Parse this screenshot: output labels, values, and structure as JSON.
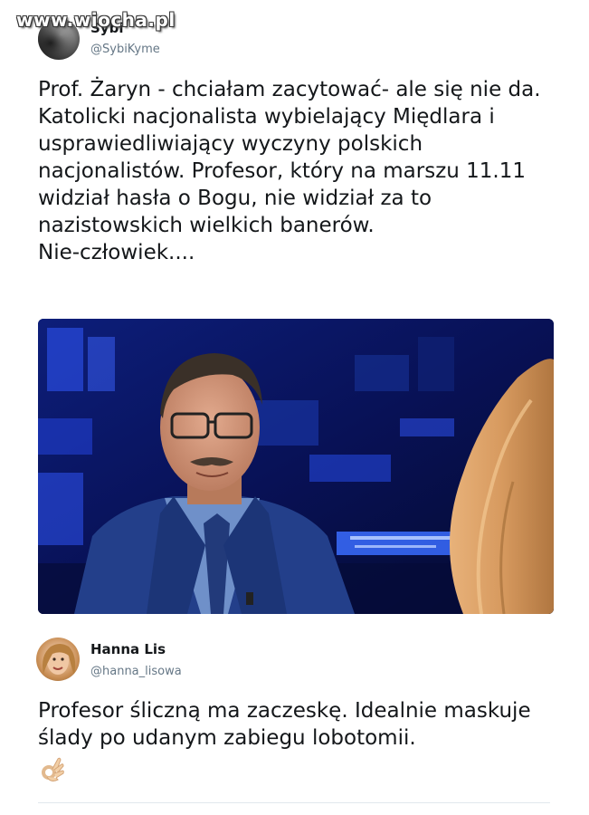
{
  "watermark": "www.wiocha.pl",
  "tweets": [
    {
      "name": "Sybi",
      "handle": "@SybiKyme",
      "text": "Prof. Żaryn - chciałam zacytować- ale się nie da.\nKatolicki nacjonalista wybielający Międlara i usprawiedliwiający wyczyny polskich nacjonalistów. Profesor, który na marszu 11.11 widział hasła o Bogu, nie widział za to nazistowskich wielkich banerów.\nNie-człowiek...."
    },
    {
      "name": "Hanna Lis",
      "handle": "@hanna_lisowa",
      "text": "Profesor śliczną ma zaczeskę. Idealnie maskuje ślady po udanym zabiegu lobotomii.",
      "emoji": "ok-hand-icon"
    }
  ]
}
